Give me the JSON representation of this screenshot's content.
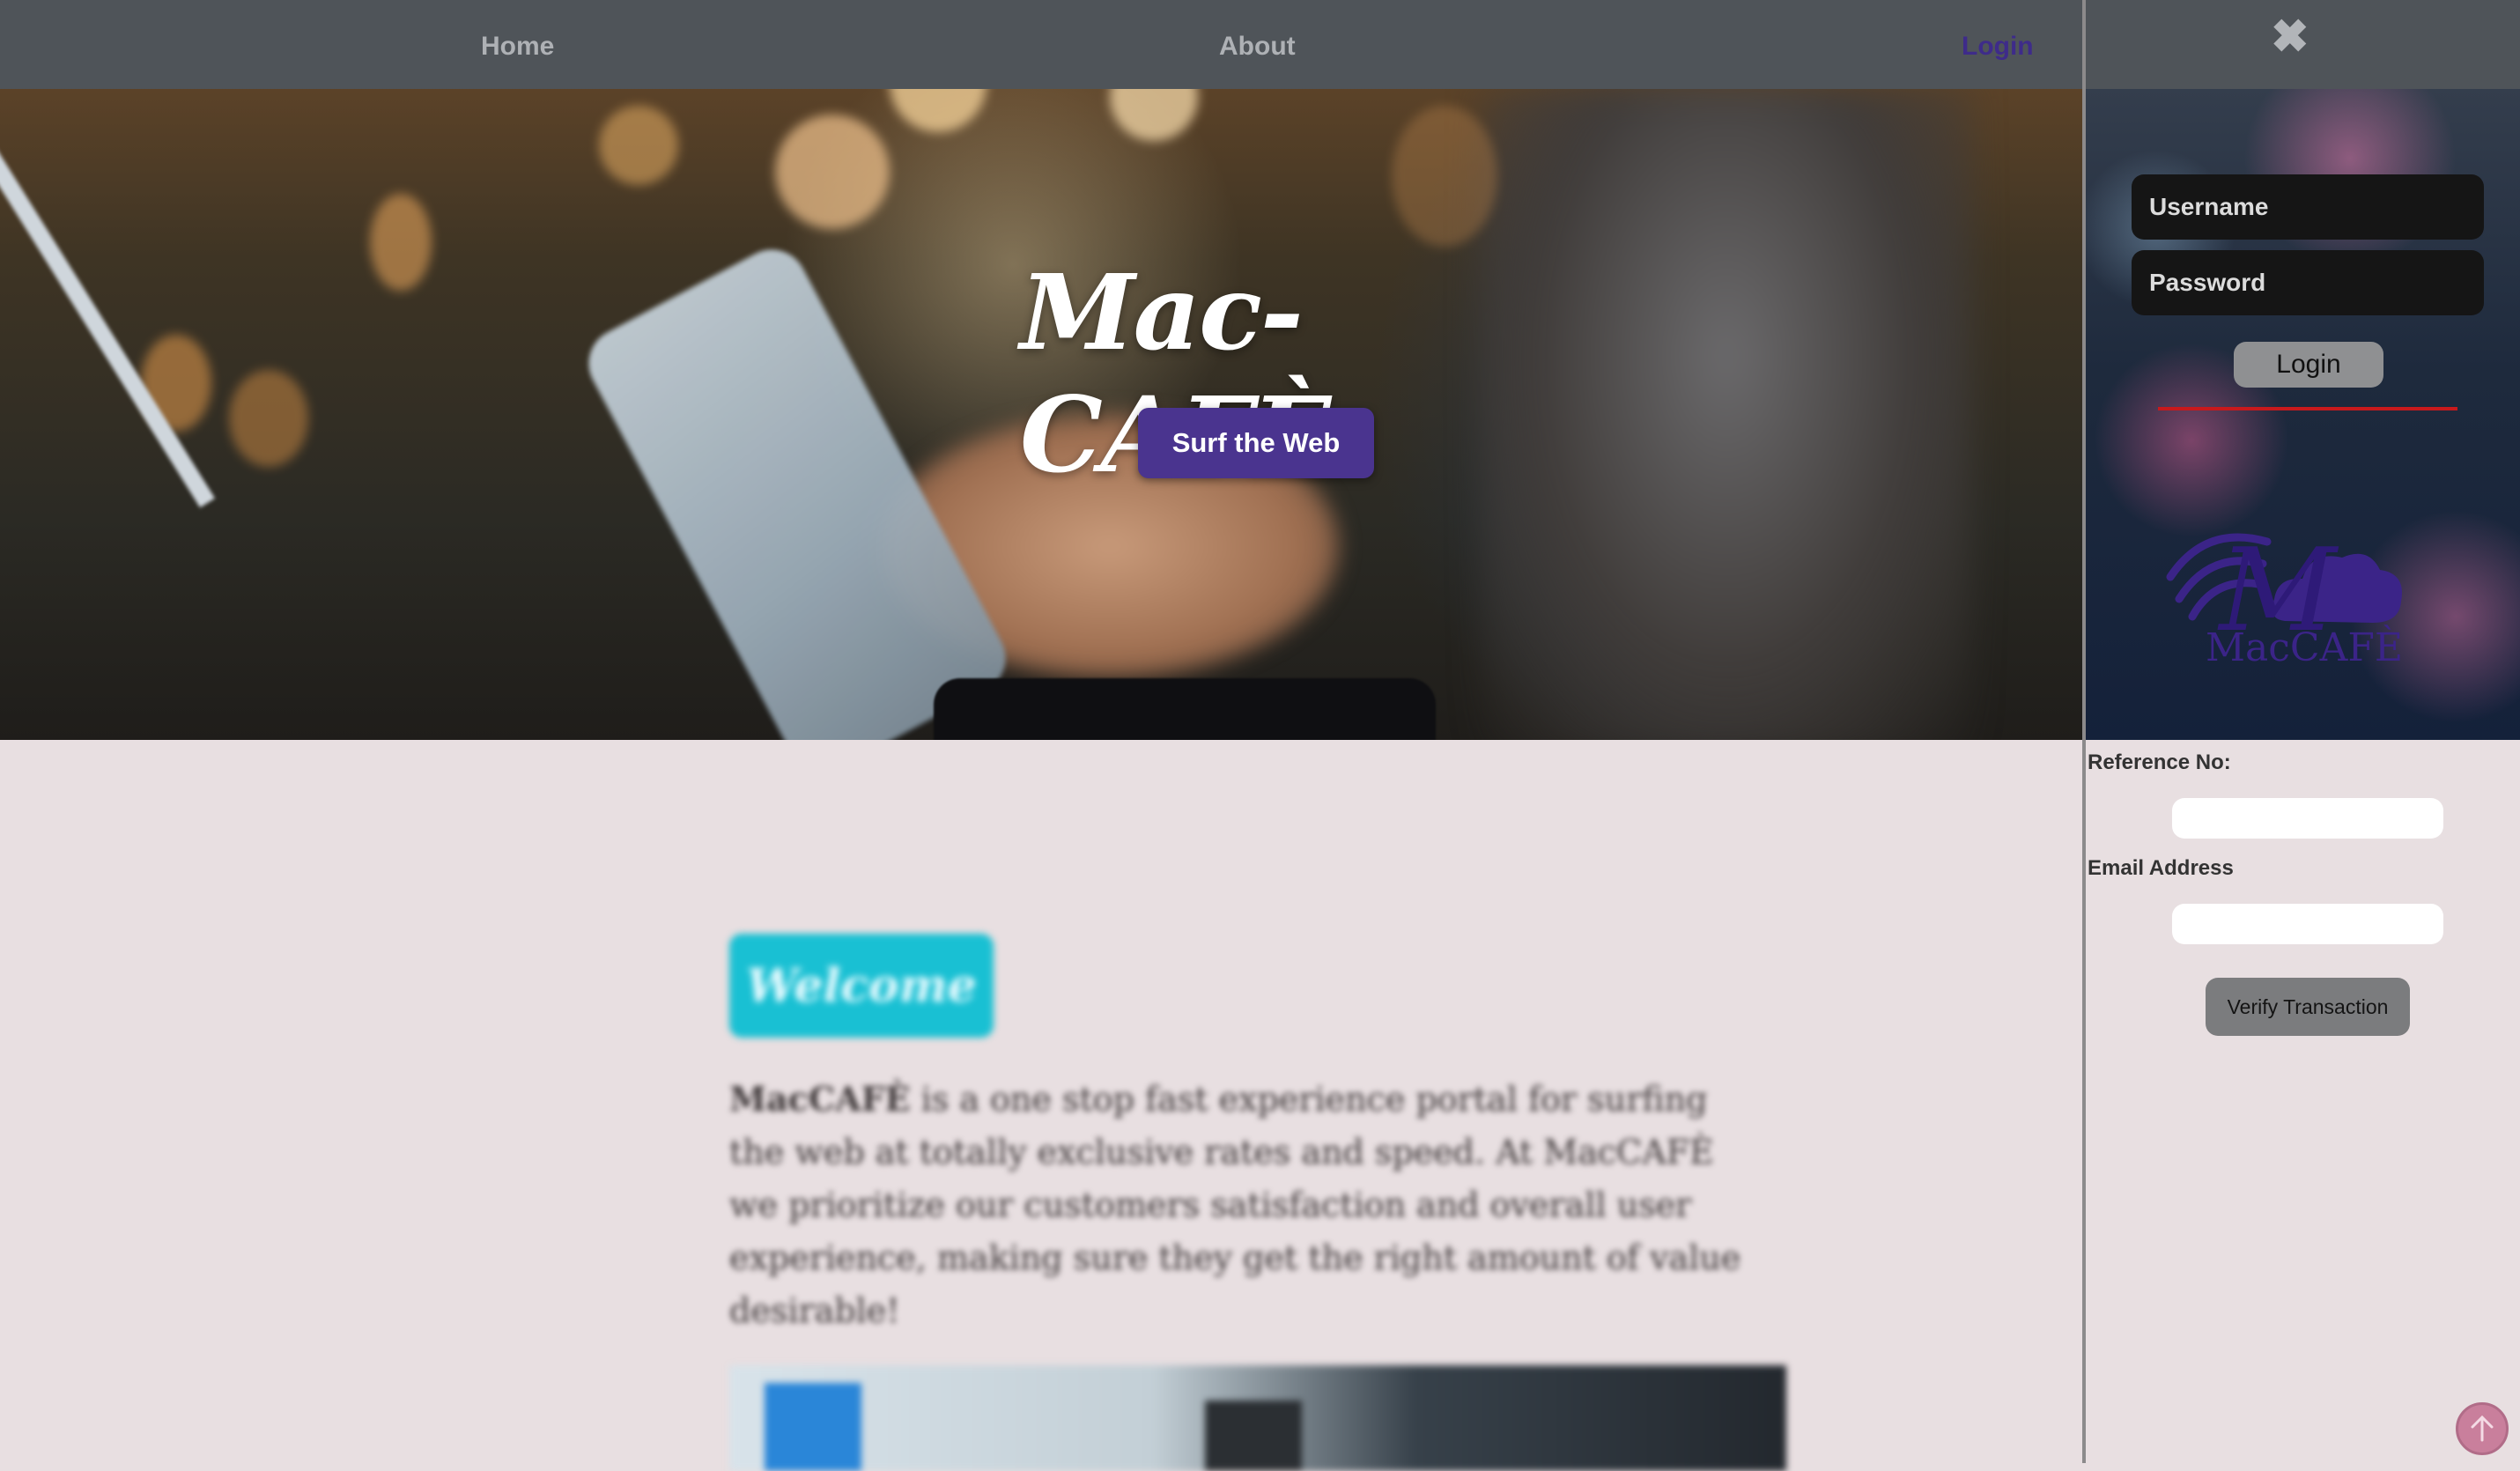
{
  "nav": {
    "home_label": "Home",
    "about_label": "About",
    "login_label": "Login"
  },
  "hero": {
    "title": "Mac-CAFÈ",
    "cta_label": "Surf the Web"
  },
  "main": {
    "welcome_badge": "Welcome",
    "about_brand": "MacCAFÈ",
    "about_text": " is a one stop fast experience portal for surfing the web at totally exclusive rates and speed. At MacCAFÈ we prioritize our customers satisfaction and overall user experience, making sure they get the right amount of value desirable!"
  },
  "login_panel": {
    "close_icon": "close-icon",
    "username_placeholder": "Username",
    "password_placeholder": "Password",
    "login_button": "Login",
    "logo_text": "MacCAFÈ",
    "logo_monogram": "M",
    "reference_label": "Reference No:",
    "email_label": "Email Address",
    "verify_button": "Verify Transaction"
  },
  "colors": {
    "nav_bg": "#4f5459",
    "accent_purple": "#4a348f",
    "login_link": "#3e2b8a",
    "welcome_cyan": "#19c0d3",
    "divider_red": "#c8191c",
    "page_bg": "#e8dfe1"
  },
  "icons": {
    "scroll_top": "arrow-up-icon"
  }
}
